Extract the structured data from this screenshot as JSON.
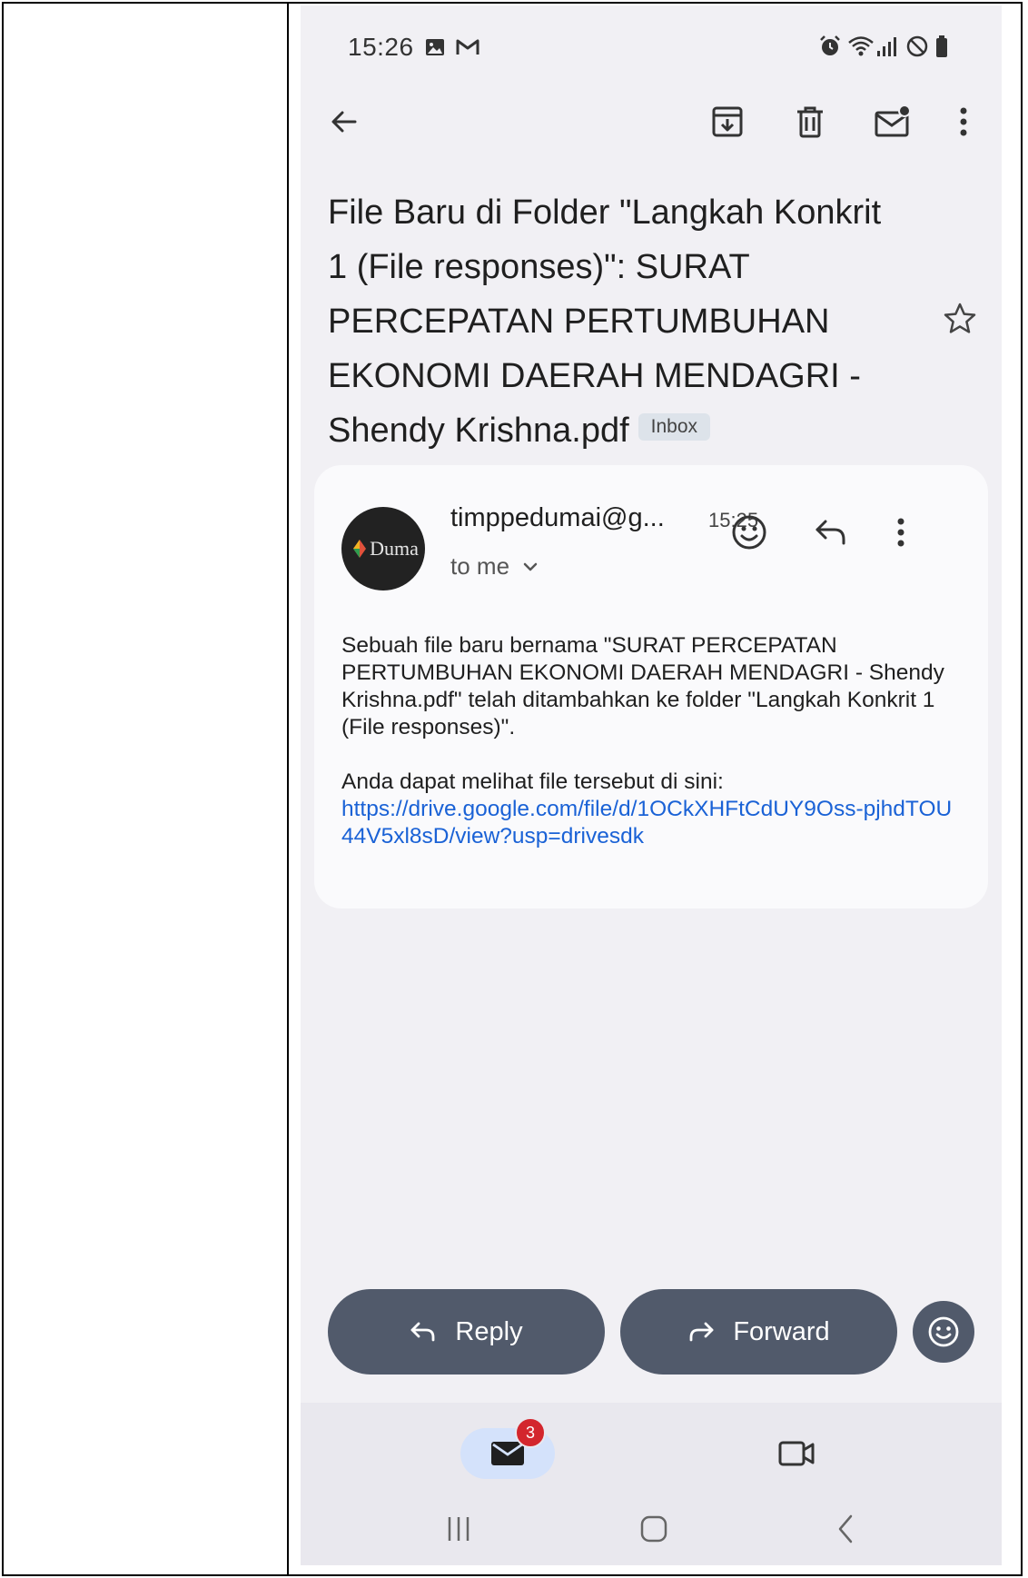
{
  "status_bar": {
    "time": "15:26",
    "left_icons": [
      "gallery-icon",
      "gmail-icon"
    ],
    "right_icons": [
      "alarm-icon",
      "wifi-icon",
      "signal-icon",
      "do-not-disturb-icon",
      "battery-icon"
    ]
  },
  "toolbar": {
    "back_icon": "arrow-left-icon",
    "actions": [
      "archive-icon",
      "delete-icon",
      "mark-unread-icon",
      "more-vert-icon"
    ]
  },
  "email": {
    "subject": "File Baru di Folder \"Langkah Konkrit 1 (File responses)\": SURAT PERCEPATAN PERTUMBUHAN EKONOMI DAERAH MENDAGRI - Shendy Krishna.pdf",
    "label": "Inbox",
    "sender": "timppedumai@g...",
    "avatar_text": "Duma",
    "time": "15:25",
    "to_label": "to me",
    "body_line1": "Sebuah file baru bernama \"SURAT PERCEPATAN PERTUMBUHAN EKONOMI DAERAH MENDAGRI - Shendy Krishna.pdf\" telah ditambahkan ke folder \"Langkah Konkrit 1 (File responses)\".",
    "body_line2": "Anda dapat melihat file tersebut di sini:",
    "link": "https://drive.google.com/file/d/1OCkXHFtCdUY9Oss-pjhdTOU44V5xl8sD/view?usp=drivesdk"
  },
  "actions": {
    "reply_label": "Reply",
    "forward_label": "Forward"
  },
  "bottom_nav": {
    "mail_badge": "3"
  },
  "colors": {
    "background": "#f1f0f4",
    "card": "#fafafc",
    "action_button": "#515a6b",
    "link": "#1a62d6",
    "badge": "#d3262d",
    "nav_pill": "#d4e2fb"
  }
}
